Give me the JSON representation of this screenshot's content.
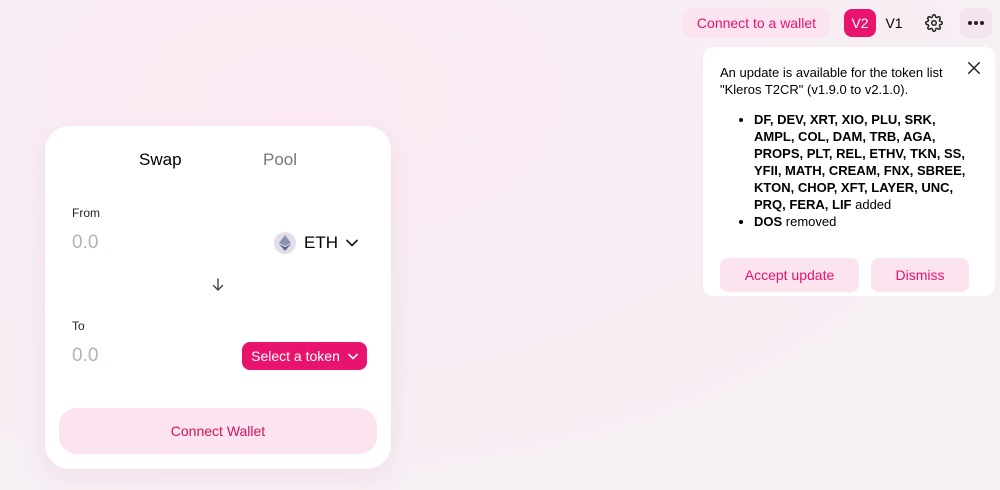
{
  "header": {
    "connect_label": "Connect to a wallet",
    "v2_label": "V2",
    "v1_label": "V1",
    "settings_icon": "gear-icon",
    "more_icon": "more-icon"
  },
  "popup": {
    "message": "An update is available for the token list \"Kleros T2CR\" (v1.9.0 to v2.1.0).",
    "added_tokens": "DF, DEV, XRT, XIO, PLU, SRK, AMPL, COL, DAM, TRB, AGA, PROPS, PLT, REL, ETHV, TKN, SS, YFII, MATH, CREAM, FNX, SBREE, KTON, CHOP, XFT, LAYER, UNC, PRQ, FERA, LIF",
    "added_suffix": " added",
    "removed_tokens": "DOS",
    "removed_suffix": " removed",
    "accept_label": "Accept update",
    "dismiss_label": "Dismiss"
  },
  "swap": {
    "tab_swap": "Swap",
    "tab_pool": "Pool",
    "from_label": "From",
    "from_amount": "0.0",
    "from_token": "ETH",
    "to_label": "To",
    "to_amount": "0.0",
    "select_token_label": "Select a token",
    "connect_wallet_label": "Connect Wallet"
  },
  "colors": {
    "accent": "#e8136d",
    "accent_light": "#fbe3ef"
  }
}
